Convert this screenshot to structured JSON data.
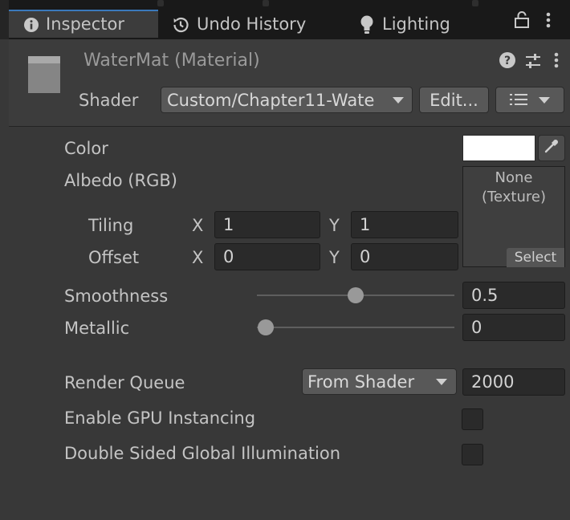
{
  "tabs": [
    {
      "label": "Inspector",
      "icon": "info-icon",
      "active": true
    },
    {
      "label": "Undo History",
      "icon": "history-icon",
      "active": false
    },
    {
      "label": "Lighting",
      "icon": "lightbulb-icon",
      "active": false
    }
  ],
  "window_icons": [
    "lock-icon",
    "kebab-menu-icon"
  ],
  "header": {
    "title": "WaterMat (Material)",
    "shader_label": "Shader",
    "shader_value": "Custom/Chapter11-Wate",
    "edit_button": "Edit...",
    "header_icons": [
      "help-icon",
      "preset-sliders-icon",
      "kebab-menu-icon"
    ]
  },
  "properties": {
    "color_label": "Color",
    "color_value": "#ffffff",
    "albedo_label": "Albedo (RGB)",
    "texture_none": "None\n(Texture)",
    "texture_select": "Select",
    "tiling_label": "Tiling",
    "tiling_x": "1",
    "tiling_y": "1",
    "offset_label": "Offset",
    "offset_x": "0",
    "offset_y": "0",
    "axis_x": "X",
    "axis_y": "Y",
    "smoothness_label": "Smoothness",
    "smoothness_value": "0.5",
    "metallic_label": "Metallic",
    "metallic_value": "0",
    "render_queue_label": "Render Queue",
    "render_queue_mode": "From Shader",
    "render_queue_value": "2000",
    "gpu_instancing_label": "Enable GPU Instancing",
    "gpu_instancing_checked": false,
    "double_sided_gi_label": "Double Sided Global Illumination",
    "double_sided_gi_checked": false
  },
  "colors": {
    "accent": "#3a79bb",
    "panel_bg": "#383838",
    "header_bg": "#3c3c3c",
    "tabbar_bg": "#191919"
  }
}
